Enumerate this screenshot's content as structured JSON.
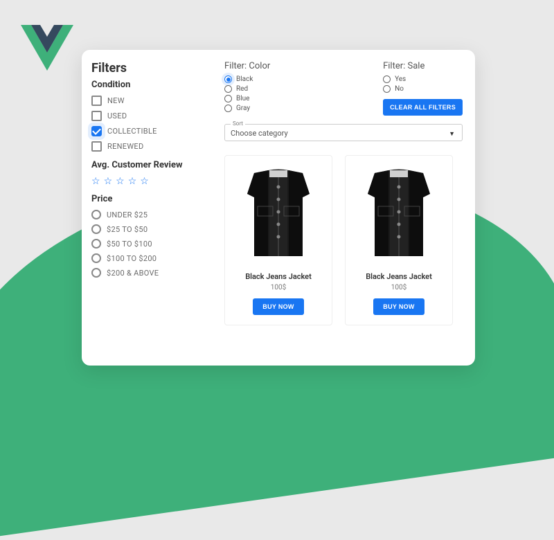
{
  "sidebar": {
    "title": "Filters",
    "condition": {
      "heading": "Condition",
      "options": [
        {
          "label": "NEW",
          "checked": false
        },
        {
          "label": "USED",
          "checked": false
        },
        {
          "label": "COLLECTIBLE",
          "checked": true
        },
        {
          "label": "RENEWED",
          "checked": false
        }
      ]
    },
    "review_heading": "Avg. Customer Review",
    "price": {
      "heading": "Price",
      "options": [
        "UNDER $25",
        "$25 TO $50",
        "$50 TO $100",
        "$100 TO $200",
        "$200 & ABOVE"
      ]
    }
  },
  "top_filters": {
    "color": {
      "heading": "Filter: Color",
      "options": [
        "Black",
        "Red",
        "Blue",
        "Gray"
      ],
      "selected": "Black"
    },
    "sale": {
      "heading": "Filter: Sale",
      "options": [
        "Yes",
        "No"
      ]
    },
    "clear_button": "CLEAR ALL FILTERS"
  },
  "sort": {
    "label": "Sort",
    "selected": "Choose category"
  },
  "products": [
    {
      "name": "Black Jeans Jacket",
      "price": "100$",
      "button": "BUY NOW"
    },
    {
      "name": "Black Jeans Jacket",
      "price": "100$",
      "button": "BUY NOW"
    }
  ]
}
